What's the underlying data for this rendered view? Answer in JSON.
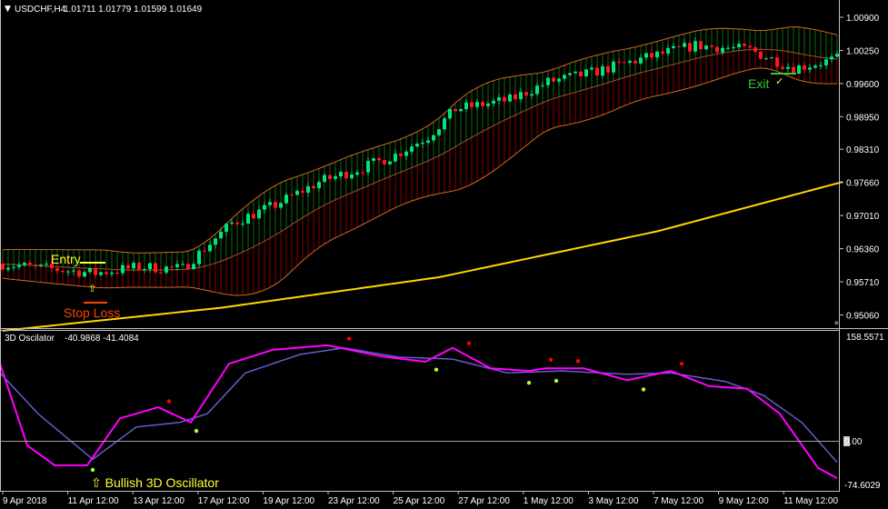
{
  "header": {
    "symbol": "USDCHF,H4",
    "ohlc": "1.01711 1.01779 1.01599 1.01649"
  },
  "oscillator_header": {
    "name": "3D Oscilator",
    "values": "-40.9868 -41.4084"
  },
  "price_axis": [
    "1.00900",
    "1.00250",
    "0.99600",
    "0.98950",
    "0.98310",
    "0.97660",
    "0.97010",
    "0.96360",
    "0.95710",
    "0.95060"
  ],
  "osc_axis": {
    "top": "158.5571",
    "zero": "0.00",
    "bottom": "-74.6029"
  },
  "time_axis": [
    "9 Apr 2018",
    "11 Apr 12:00",
    "13 Apr 12:00",
    "17 Apr 12:00",
    "19 Apr 12:00",
    "23 Apr 12:00",
    "25 Apr 12:00",
    "27 Apr 12:00",
    "1 May 12:00",
    "3 May 12:00",
    "7 May 12:00",
    "9 May 12:00",
    "11 May 12:00"
  ],
  "annotations": {
    "entry": "Entry",
    "stop_loss": "Stop Loss",
    "exit": "Exit",
    "exit_mark": "✓",
    "arrow": "⇧",
    "bullish": "⇧ Bullish 3D Oscillator"
  },
  "colors": {
    "bull": "#00e676",
    "bear": "#ff1a1a",
    "band": "#d2691e",
    "ma": "#ffd700",
    "osc_fast": "#ff00ff",
    "osc_slow": "#6a5acd",
    "entry": "#ffff33",
    "stop": "#ff4500",
    "exit": "#32cd32",
    "dot_red": "#ff0000",
    "dot_green": "#adff2f"
  },
  "chart_data": {
    "type": "candlestick",
    "bars": 154,
    "price_range": [
      0.9506,
      1.009
    ],
    "price_keypoints": [
      [
        0,
        0.9606
      ],
      [
        10,
        0.9595
      ],
      [
        17,
        0.9588
      ],
      [
        25,
        0.96
      ],
      [
        33,
        0.9597
      ],
      [
        42,
        0.9686
      ],
      [
        50,
        0.9722
      ],
      [
        58,
        0.9767
      ],
      [
        66,
        0.9795
      ],
      [
        72,
        0.982
      ],
      [
        78,
        0.9856
      ],
      [
        83,
        0.991
      ],
      [
        93,
        0.9928
      ],
      [
        100,
        0.9963
      ],
      [
        108,
        0.9981
      ],
      [
        117,
        1.0008
      ],
      [
        127,
        1.0035
      ],
      [
        137,
        1.0026
      ],
      [
        145,
        0.999
      ],
      [
        153,
        1.0008
      ]
    ],
    "ma_keypoints": [
      [
        0,
        0.9475
      ],
      [
        40,
        0.952
      ],
      [
        80,
        0.958
      ],
      [
        120,
        0.967
      ],
      [
        154,
        0.9767
      ]
    ],
    "oscillator": {
      "range": [
        -74.6029,
        158.5571
      ],
      "fast": [
        [
          0,
          117
        ],
        [
          5,
          -7
        ],
        [
          10,
          -37
        ],
        [
          16,
          -37
        ],
        [
          22,
          34
        ],
        [
          29,
          51
        ],
        [
          35,
          28
        ],
        [
          42,
          117
        ],
        [
          50,
          138
        ],
        [
          60,
          145
        ],
        [
          70,
          128
        ],
        [
          78,
          120
        ],
        [
          83,
          141
        ],
        [
          90,
          110
        ],
        [
          97,
          106
        ],
        [
          100,
          110
        ],
        [
          107,
          110
        ],
        [
          115,
          92
        ],
        [
          123,
          106
        ],
        [
          130,
          83
        ],
        [
          137,
          79
        ],
        [
          143,
          41
        ],
        [
          150,
          -41
        ],
        [
          154,
          -59
        ]
      ],
      "slow": [
        [
          0,
          103
        ],
        [
          7,
          41
        ],
        [
          17,
          -28
        ],
        [
          25,
          21
        ],
        [
          33,
          28
        ],
        [
          38,
          41
        ],
        [
          45,
          103
        ],
        [
          55,
          131
        ],
        [
          63,
          141
        ],
        [
          73,
          127
        ],
        [
          83,
          124
        ],
        [
          93,
          103
        ],
        [
          103,
          106
        ],
        [
          115,
          101
        ],
        [
          123,
          103
        ],
        [
          133,
          90
        ],
        [
          140,
          69
        ],
        [
          147,
          28
        ],
        [
          154,
          -37
        ]
      ],
      "red_dots": [
        [
          31,
          60
        ],
        [
          64,
          155
        ],
        [
          86,
          148
        ],
        [
          101,
          123
        ],
        [
          106,
          121
        ],
        [
          125,
          117
        ]
      ],
      "green_dots": [
        [
          17,
          -44
        ],
        [
          36,
          15
        ],
        [
          80,
          108
        ],
        [
          97,
          88
        ],
        [
          102,
          91
        ],
        [
          118,
          78
        ]
      ]
    }
  }
}
